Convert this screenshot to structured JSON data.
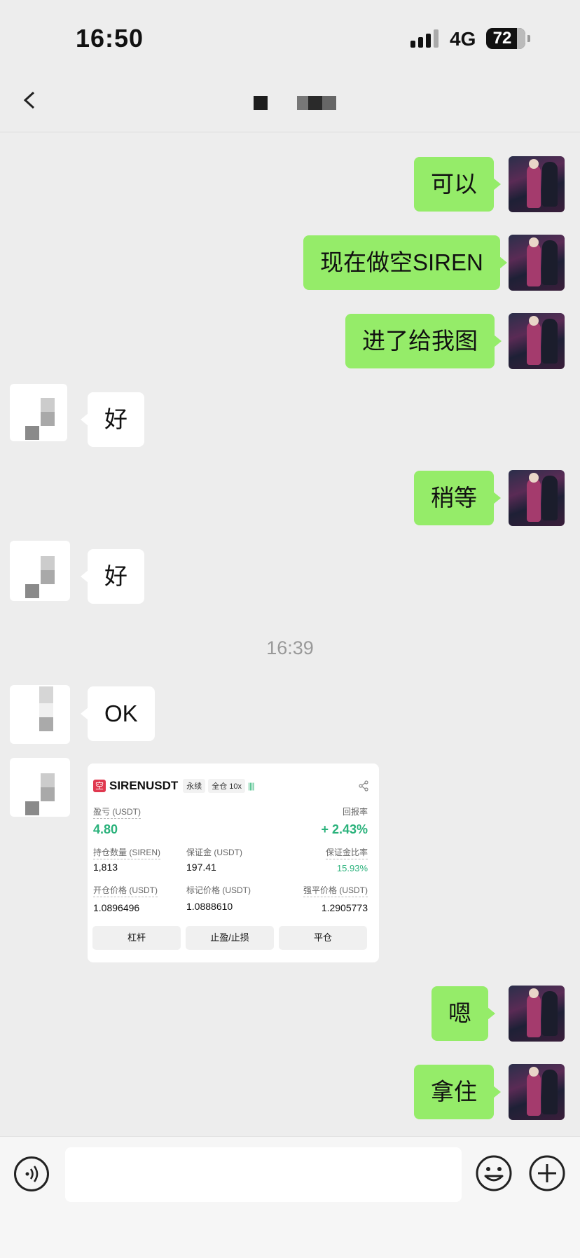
{
  "status_bar": {
    "time": "16:50",
    "network": "4G",
    "battery": "72"
  },
  "nav": {
    "title": "",
    "more": "···"
  },
  "messages": [
    {
      "side": "me",
      "text": "可以"
    },
    {
      "side": "me",
      "text": "现在做空SIREN"
    },
    {
      "side": "me",
      "text": "进了给我图"
    },
    {
      "side": "other",
      "text": "好"
    },
    {
      "side": "me",
      "text": "稍等"
    },
    {
      "side": "other",
      "text": "好"
    },
    {
      "side": "other",
      "text": "OK"
    },
    {
      "side": "me",
      "text": "嗯"
    },
    {
      "side": "me",
      "text": "拿住"
    }
  ],
  "timestamp": "16:39",
  "position_card": {
    "badge": "空",
    "symbol": "SIRENUSDT",
    "tag_perpetual": "永续",
    "tag_margin": "全仓 10x",
    "pnl_label": "盈亏 (USDT)",
    "pnl_value": "4.80",
    "roe_label": "回报率",
    "roe_value": "+ 2.43%",
    "qty_label": "持仓数量 (SIREN)",
    "qty_value": "1,813",
    "margin_label": "保证金 (USDT)",
    "margin_value": "197.41",
    "margin_ratio_label": "保证金比率",
    "margin_ratio_value": "15.93%",
    "entry_label": "开仓价格 (USDT)",
    "entry_value": "1.0896496",
    "mark_label": "标记价格 (USDT)",
    "mark_value": "1.0888610",
    "liq_label": "强平价格 (USDT)",
    "liq_value": "1.2905773",
    "btn_leverage": "杠杆",
    "btn_tpsl": "止盈/止损",
    "btn_close": "平仓"
  },
  "colors": {
    "my_bubble": "#95ec69",
    "profit_green": "#2ab27b",
    "short_red": "#e0384f",
    "background": "#ededed"
  }
}
